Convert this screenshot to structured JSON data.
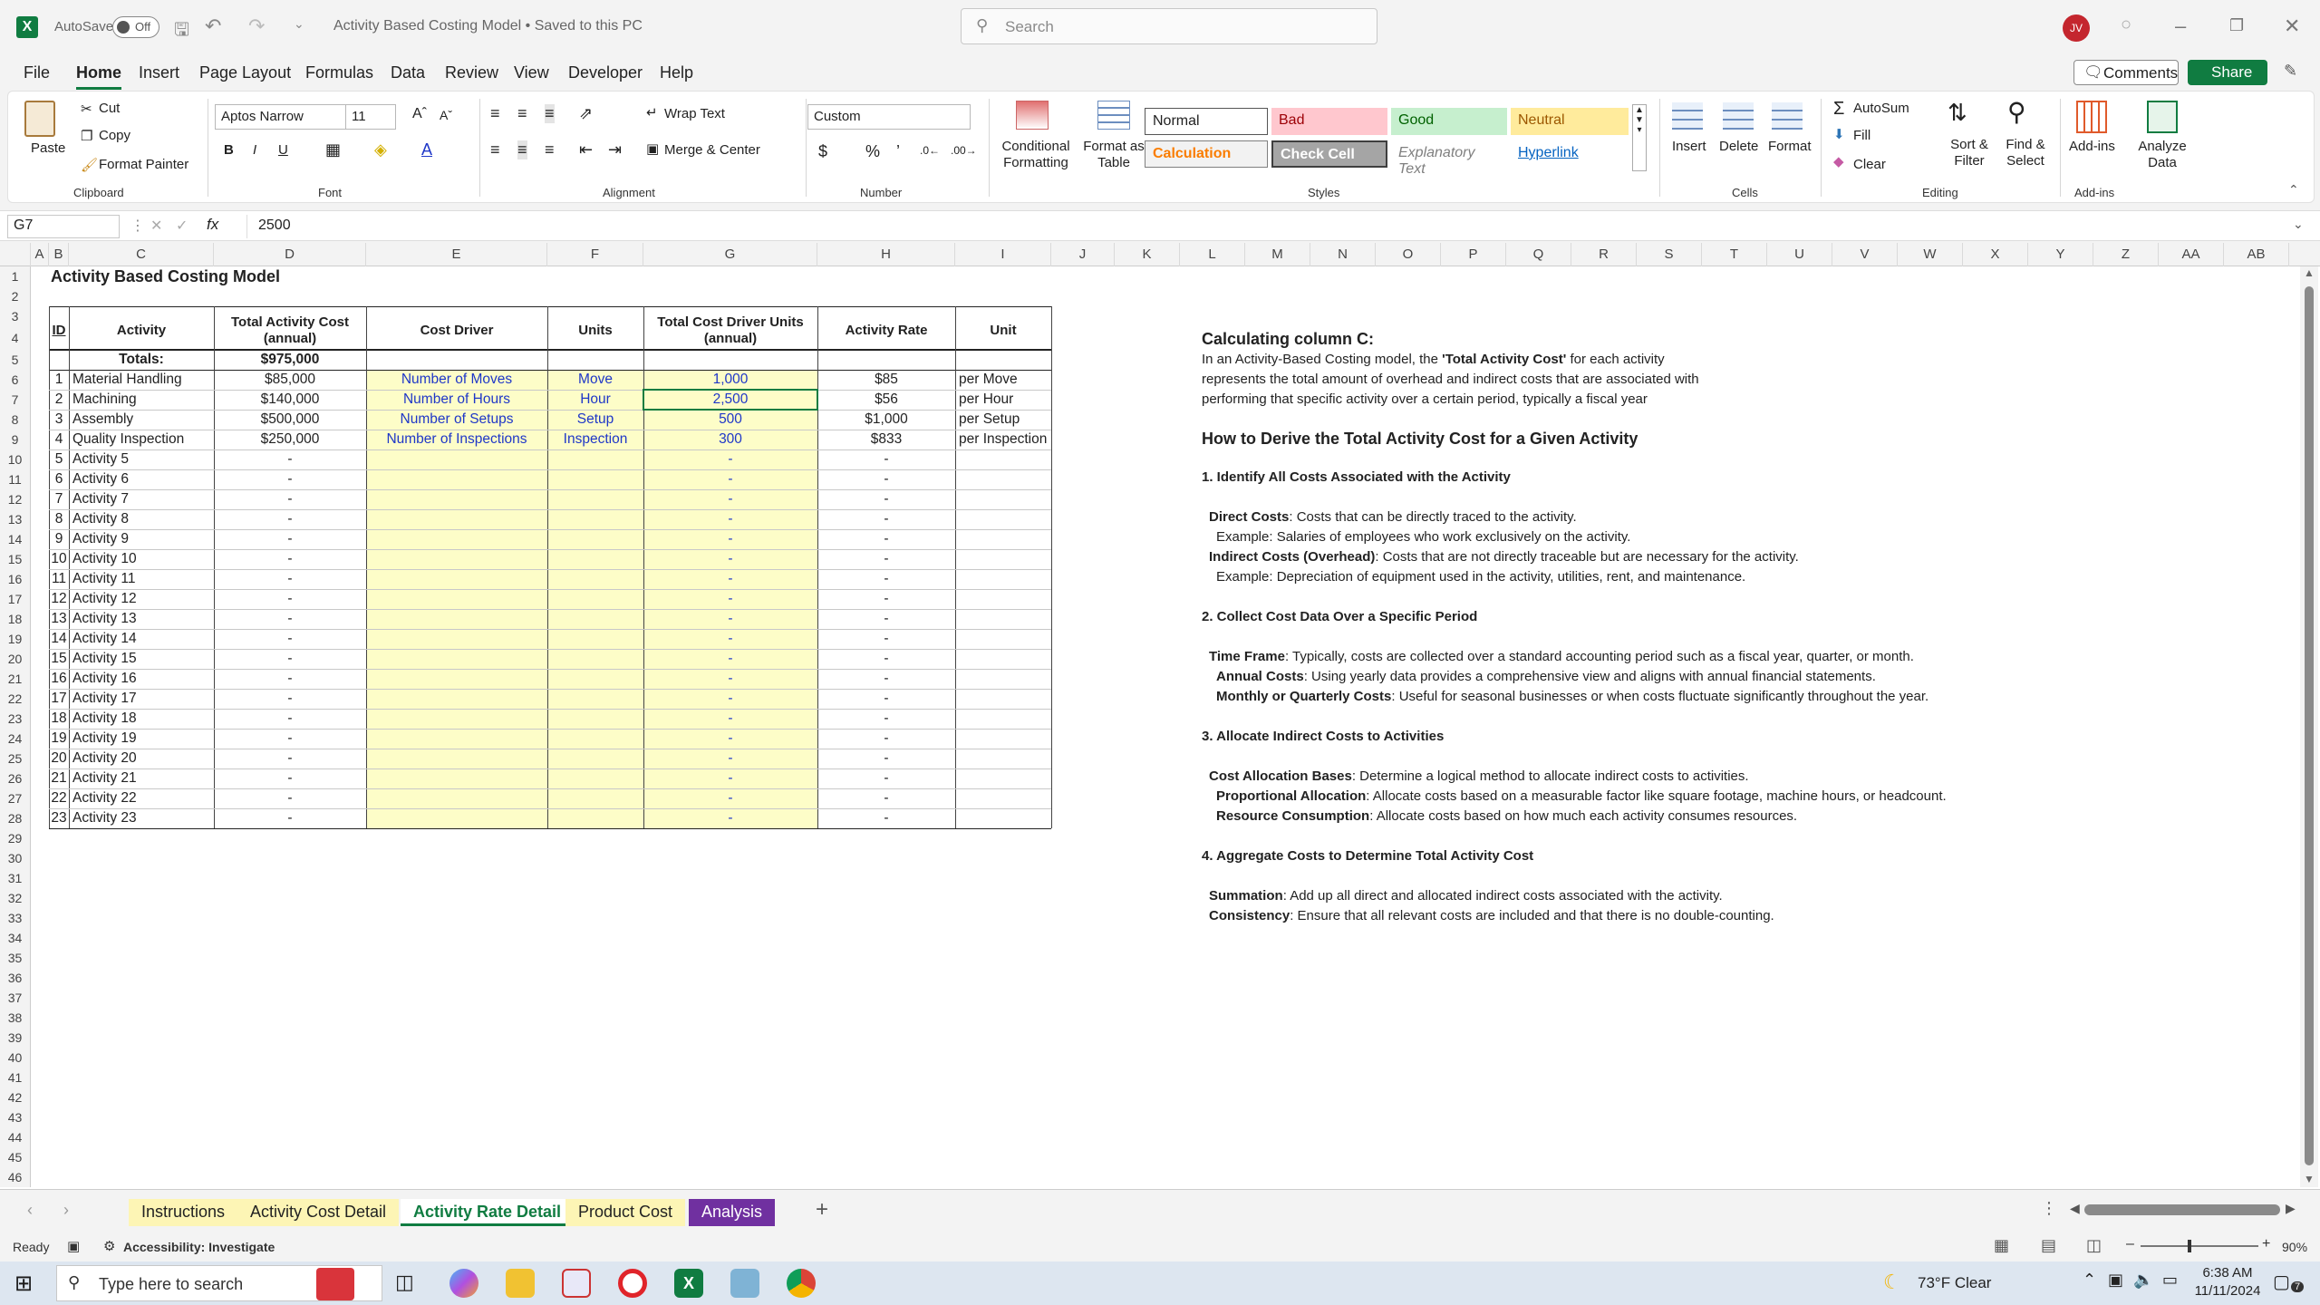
{
  "titlebar": {
    "autosave_label": "AutoSave",
    "autosave_state": "Off",
    "doc_title": "Activity Based Costing Model • Saved to this PC",
    "search_placeholder": "Search",
    "avatar_initials": "JV"
  },
  "menu": {
    "items": [
      "File",
      "Home",
      "Insert",
      "Page Layout",
      "Formulas",
      "Data",
      "Review",
      "View",
      "Developer",
      "Help"
    ],
    "active": "Home",
    "comments_label": "Comments",
    "share_label": "Share"
  },
  "ribbon": {
    "clipboard": {
      "paste": "Paste",
      "cut": "Cut",
      "copy": "Copy",
      "format_painter": "Format Painter",
      "group": "Clipboard"
    },
    "font": {
      "family": "Aptos Narrow",
      "size": "11",
      "group": "Font"
    },
    "alignment": {
      "wrap_text": "Wrap Text",
      "merge_center": "Merge & Center",
      "group": "Alignment"
    },
    "number": {
      "format": "Custom",
      "group": "Number"
    },
    "styles": {
      "conditional": "Conditional Formatting",
      "format_table": "Format as Table",
      "normal": "Normal",
      "bad": "Bad",
      "good": "Good",
      "neutral": "Neutral",
      "calculation": "Calculation",
      "check_cell": "Check Cell",
      "explanatory": "Explanatory Text",
      "hyperlink": "Hyperlink",
      "group": "Styles"
    },
    "cells": {
      "insert": "Insert",
      "delete": "Delete",
      "format": "Format",
      "group": "Cells"
    },
    "editing": {
      "autosum": "AutoSum",
      "fill": "Fill",
      "clear": "Clear",
      "sort_filter": "Sort & Filter",
      "find_select": "Find & Select",
      "group": "Editing"
    },
    "addins": {
      "addins": "Add-ins",
      "analyze": "Analyze Data",
      "group": "Add-ins"
    }
  },
  "formula_bar": {
    "name_box": "G7",
    "fx": "fx",
    "value": "2500"
  },
  "columns": [
    "A",
    "B",
    "C",
    "D",
    "E",
    "F",
    "G",
    "H",
    "I",
    "J",
    "K",
    "L",
    "M",
    "N",
    "O",
    "P",
    "Q",
    "R",
    "S",
    "T",
    "U",
    "V",
    "W",
    "X",
    "Y",
    "Z",
    "AA",
    "AB"
  ],
  "sheet": {
    "title": "Activity Based Costing Model",
    "headers": {
      "id": "ID",
      "activity": "Activity",
      "total_cost": "Total Activity Cost (annual)",
      "cost_driver": "Cost Driver",
      "units": "Units",
      "total_units": "Total Cost Driver Units (annual)",
      "rate": "Activity Rate",
      "unit": "Unit"
    },
    "totals_label": "Totals:",
    "totals_value": "$975,000",
    "rows": [
      {
        "id": "1",
        "activity": "Material Handling",
        "cost": "$85,000",
        "driver": "Number of Moves",
        "units": "Move",
        "total_units": "1,000",
        "rate": "$85",
        "unit": "per Move"
      },
      {
        "id": "2",
        "activity": "Machining",
        "cost": "$140,000",
        "driver": "Number of Hours",
        "units": "Hour",
        "total_units": "2,500",
        "rate": "$56",
        "unit": "per Hour"
      },
      {
        "id": "3",
        "activity": "Assembly",
        "cost": "$500,000",
        "driver": "Number of Setups",
        "units": "Setup",
        "total_units": "500",
        "rate": "$1,000",
        "unit": "per Setup"
      },
      {
        "id": "4",
        "activity": "Quality Inspection",
        "cost": "$250,000",
        "driver": "Number of Inspections",
        "units": "Inspection",
        "total_units": "300",
        "rate": "$833",
        "unit": "per Inspection"
      },
      {
        "id": "5",
        "activity": "Activity 5",
        "cost": "-",
        "driver": "",
        "units": "",
        "total_units": "-",
        "rate": "-",
        "unit": ""
      },
      {
        "id": "6",
        "activity": "Activity 6",
        "cost": "-",
        "driver": "",
        "units": "",
        "total_units": "-",
        "rate": "-",
        "unit": ""
      },
      {
        "id": "7",
        "activity": "Activity 7",
        "cost": "-",
        "driver": "",
        "units": "",
        "total_units": "-",
        "rate": "-",
        "unit": ""
      },
      {
        "id": "8",
        "activity": "Activity 8",
        "cost": "-",
        "driver": "",
        "units": "",
        "total_units": "-",
        "rate": "-",
        "unit": ""
      },
      {
        "id": "9",
        "activity": "Activity 9",
        "cost": "-",
        "driver": "",
        "units": "",
        "total_units": "-",
        "rate": "-",
        "unit": ""
      },
      {
        "id": "10",
        "activity": "Activity 10",
        "cost": "-",
        "driver": "",
        "units": "",
        "total_units": "-",
        "rate": "-",
        "unit": ""
      },
      {
        "id": "11",
        "activity": "Activity 11",
        "cost": "-",
        "driver": "",
        "units": "",
        "total_units": "-",
        "rate": "-",
        "unit": ""
      },
      {
        "id": "12",
        "activity": "Activity 12",
        "cost": "-",
        "driver": "",
        "units": "",
        "total_units": "-",
        "rate": "-",
        "unit": ""
      },
      {
        "id": "13",
        "activity": "Activity 13",
        "cost": "-",
        "driver": "",
        "units": "",
        "total_units": "-",
        "rate": "-",
        "unit": ""
      },
      {
        "id": "14",
        "activity": "Activity 14",
        "cost": "-",
        "driver": "",
        "units": "",
        "total_units": "-",
        "rate": "-",
        "unit": ""
      },
      {
        "id": "15",
        "activity": "Activity 15",
        "cost": "-",
        "driver": "",
        "units": "",
        "total_units": "-",
        "rate": "-",
        "unit": ""
      },
      {
        "id": "16",
        "activity": "Activity 16",
        "cost": "-",
        "driver": "",
        "units": "",
        "total_units": "-",
        "rate": "-",
        "unit": ""
      },
      {
        "id": "17",
        "activity": "Activity 17",
        "cost": "-",
        "driver": "",
        "units": "",
        "total_units": "-",
        "rate": "-",
        "unit": ""
      },
      {
        "id": "18",
        "activity": "Activity 18",
        "cost": "-",
        "driver": "",
        "units": "",
        "total_units": "-",
        "rate": "-",
        "unit": ""
      },
      {
        "id": "19",
        "activity": "Activity 19",
        "cost": "-",
        "driver": "",
        "units": "",
        "total_units": "-",
        "rate": "-",
        "unit": ""
      },
      {
        "id": "20",
        "activity": "Activity 20",
        "cost": "-",
        "driver": "",
        "units": "",
        "total_units": "-",
        "rate": "-",
        "unit": ""
      },
      {
        "id": "21",
        "activity": "Activity 21",
        "cost": "-",
        "driver": "",
        "units": "",
        "total_units": "-",
        "rate": "-",
        "unit": ""
      },
      {
        "id": "22",
        "activity": "Activity 22",
        "cost": "-",
        "driver": "",
        "units": "",
        "total_units": "-",
        "rate": "-",
        "unit": ""
      },
      {
        "id": "23",
        "activity": "Activity 23",
        "cost": "-",
        "driver": "",
        "units": "",
        "total_units": "-",
        "rate": "-",
        "unit": ""
      }
    ]
  },
  "notes": {
    "heading1": "Calculating column C:",
    "intro1_pre": "In an Activity-Based Costing model, the ",
    "intro1_bold": "'Total Activity Cost'",
    "intro1_post": " for each activity",
    "intro2": "represents the total amount of overhead and indirect costs that are associated with",
    "intro3": "performing that specific activity over a certain period, typically a fiscal year",
    "heading2": "How to Derive the Total Activity Cost for a Given Activity",
    "s1": "1. Identify All Costs Associated with the Activity",
    "s1a_b": "Direct Costs",
    "s1a": ": Costs that can be directly traced to the activity.",
    "s1b": "Example: Salaries of employees who work exclusively on the activity.",
    "s1c_b": "Indirect Costs (Overhead)",
    "s1c": ": Costs that are not directly traceable but are necessary for the activity.",
    "s1d": "Example: Depreciation of equipment used in the activity, utilities, rent, and maintenance.",
    "s2": "2. Collect Cost Data Over a Specific Period",
    "s2a_b": "Time Frame",
    "s2a": ": Typically, costs are collected over a standard accounting period such as a fiscal year, quarter, or month.",
    "s2b_b": "Annual Costs",
    "s2b": ": Using yearly data provides a comprehensive view and aligns with annual financial statements.",
    "s2c_b": "Monthly or Quarterly Costs",
    "s2c": ": Useful for seasonal businesses or when costs fluctuate significantly throughout the year.",
    "s3": "3. Allocate Indirect Costs to Activities",
    "s3a_b": "Cost Allocation Bases",
    "s3a": ": Determine a logical method to allocate indirect costs to activities.",
    "s3b_b": "Proportional Allocation",
    "s3b": ": Allocate costs based on a measurable factor like square footage, machine hours, or headcount.",
    "s3c_b": "Resource Consumption",
    "s3c": ": Allocate costs based on how much each activity consumes resources.",
    "s4": "4. Aggregate Costs to Determine Total Activity Cost",
    "s4a_b": "Summation",
    "s4a": ": Add up all direct and allocated indirect costs associated with the activity.",
    "s4b_b": "Consistency",
    "s4b": ": Ensure that all relevant costs are included and that there is no double-counting."
  },
  "tabs": {
    "items": [
      "Instructions",
      "Activity Cost Detail",
      "Activity Rate Detail",
      "Product Cost",
      "Analysis"
    ],
    "active": "Activity Rate Detail",
    "colors": {
      "Instructions": "#fdf5b5",
      "Activity Cost Detail": "#fdf5b5",
      "Activity Rate Detail": "#ffffff",
      "Product Cost": "#fdf5b5",
      "Analysis": "#7030a0"
    }
  },
  "statusbar": {
    "ready": "Ready",
    "accessibility": "Accessibility: Investigate",
    "zoom": "90%"
  },
  "taskbar": {
    "search_placeholder": "Type here to search",
    "weather": "73°F  Clear",
    "time": "6:38 AM",
    "date": "11/11/2024",
    "notifications": "7"
  }
}
